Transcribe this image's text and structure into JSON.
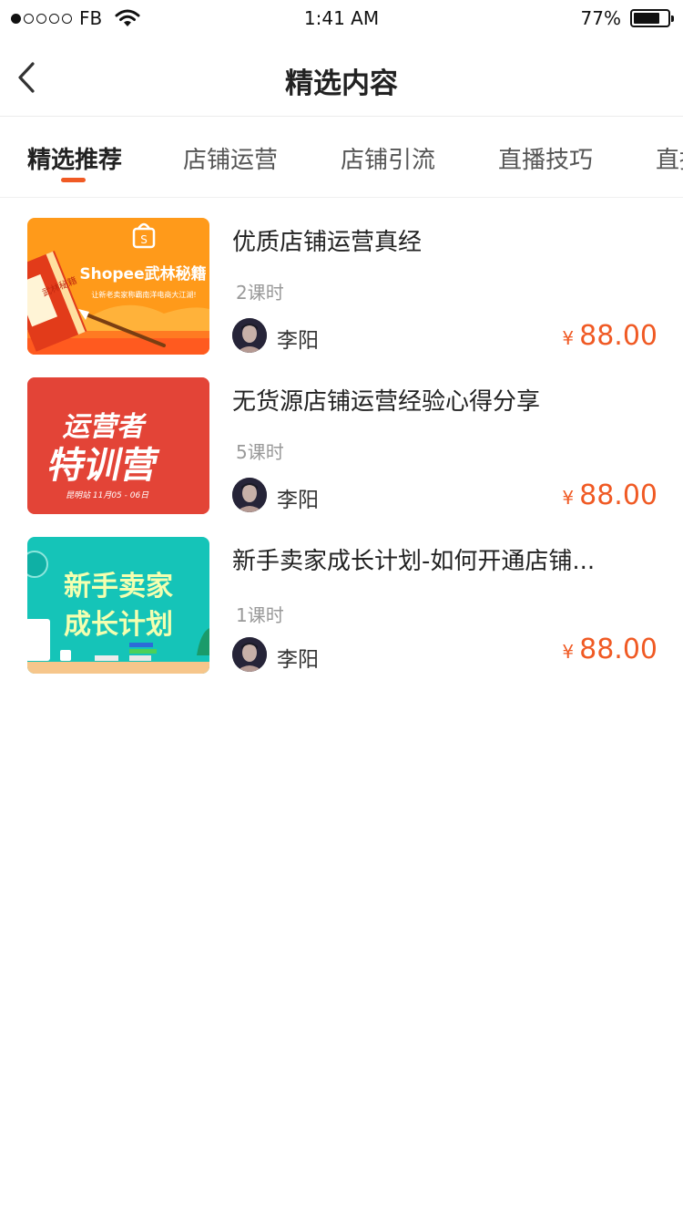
{
  "status_bar": {
    "carrier": "FB",
    "time": "1:41 AM",
    "battery_percent": "77%",
    "battery_level": 0.77,
    "signal_filled_dots": 1,
    "signal_total_dots": 5
  },
  "nav": {
    "title": "精选内容",
    "back_icon": "chevron-left-icon"
  },
  "tabs": [
    {
      "label": "精选推荐",
      "active": true
    },
    {
      "label": "店铺运营",
      "active": false
    },
    {
      "label": "店铺引流",
      "active": false
    },
    {
      "label": "直播技巧",
      "active": false
    },
    {
      "label": "直播",
      "active": false
    }
  ],
  "accent_color": "#f05a24",
  "courses": [
    {
      "title": "优质店铺运营真经",
      "lessons": "2课时",
      "author": "李阳",
      "currency": "¥",
      "price": "88.00",
      "thumb": {
        "main": "Shopee武林秘籍",
        "sub": "让新老卖家称霸南洋电商大江湖!",
        "book_text": "武林秘籍"
      }
    },
    {
      "title": "无货源店铺运营经验心得分享",
      "lessons": "5课时",
      "author": "李阳",
      "currency": "¥",
      "price": "88.00",
      "thumb": {
        "line1": "运营者",
        "line2": "特训营",
        "sub": "昆明站  11月05 - 06日"
      }
    },
    {
      "title": "新手卖家成长计划-如何开通店铺...",
      "lessons": "1课时",
      "author": "李阳",
      "currency": "¥",
      "price": "88.00",
      "thumb": {
        "line1": "新手卖家",
        "line2": "成长计划"
      }
    }
  ]
}
